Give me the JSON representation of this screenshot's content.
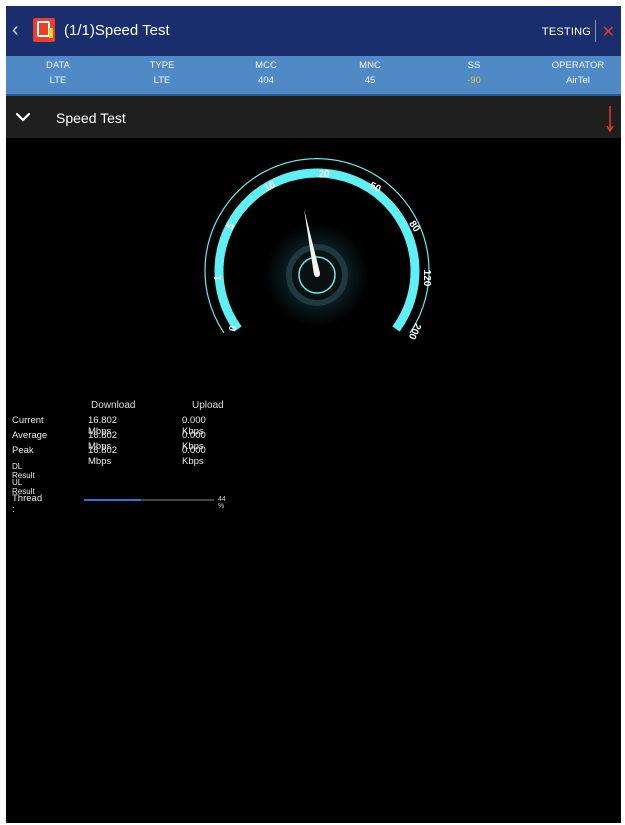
{
  "appbar": {
    "title": "(1/1)Speed Test",
    "status": "TESTING",
    "back_icon": "chevron-left-icon",
    "close_icon": "close-icon",
    "accent": "#e8362a",
    "background": "#1a2e6e"
  },
  "info": [
    {
      "label": "DATA",
      "value": "LTE"
    },
    {
      "label": "TYPE",
      "value": "LTE"
    },
    {
      "label": "MCC",
      "value": "404"
    },
    {
      "label": "MNC",
      "value": "45"
    },
    {
      "label": "SS",
      "value": "-90"
    },
    {
      "label": "OPERATOR",
      "value": "AirTel"
    }
  ],
  "section": {
    "title": "Speed Test",
    "expand_icon": "chevron-down-icon",
    "indicator_icon": "download-arrow-icon"
  },
  "gauge": {
    "ticks": [
      "0",
      "1",
      "5",
      "10",
      "20",
      "50",
      "80",
      "120",
      "200"
    ],
    "needle_value": 16.802,
    "arc_color": "#5ef0f4"
  },
  "stats": {
    "headers": {
      "download": "Download",
      "upload": "Upload"
    },
    "rows": [
      {
        "label": "Current",
        "download": "16.802 Mbps",
        "upload": "0.000 Kbps"
      },
      {
        "label": "Average",
        "download": "16.802 Mbps",
        "upload": "0.000 Kbps"
      },
      {
        "label": "Peak",
        "download": "16.802 Mbps",
        "upload": "0.000 Kbps"
      }
    ],
    "dl_result_label": "DL Result",
    "ul_result_label": "UL Result",
    "thread_label": "Thread :",
    "thread_progress": 0.44,
    "thread_percent_text": "44 %"
  }
}
